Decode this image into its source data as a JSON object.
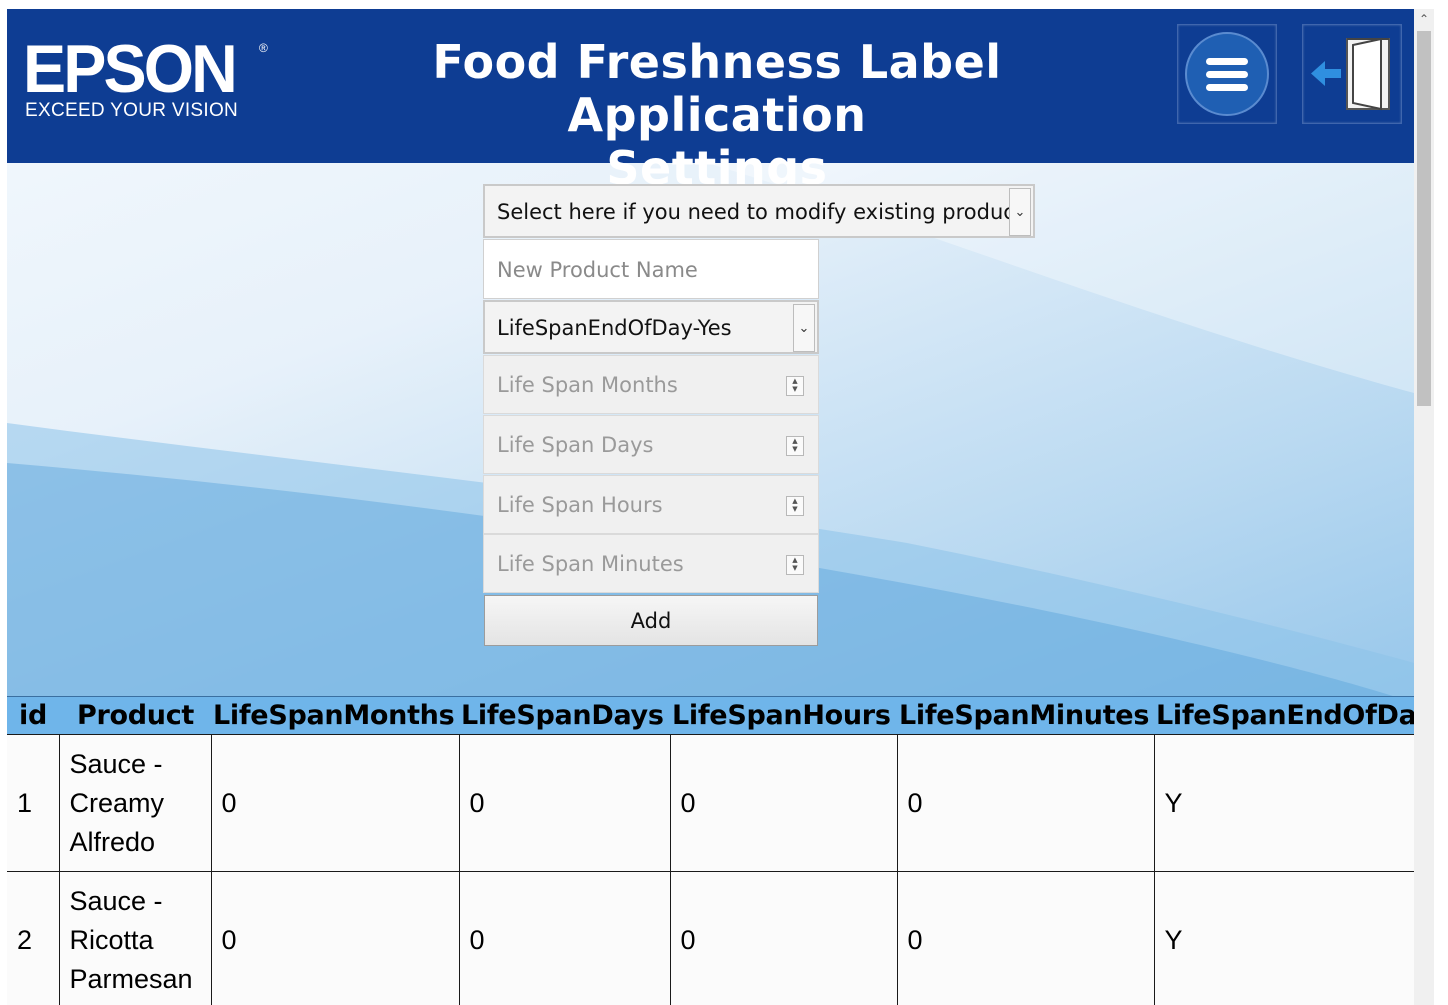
{
  "header": {
    "logo_text": "EPSON",
    "logo_tagline": "EXCEED YOUR VISION",
    "title_line1": "Food Freshness Label Application",
    "title_line2": "Settings",
    "colors": {
      "header_bg": "#0e3d93",
      "table_header_bg": "#6fb5ea"
    },
    "menu_icon": "hamburger-menu-icon",
    "logout_icon": "logout-door-icon"
  },
  "form": {
    "product_select": {
      "value": "Select here if you need to modify existing product",
      "icon": "chevron-down-icon"
    },
    "new_product_name": {
      "placeholder": "New Product Name",
      "value": ""
    },
    "end_of_day_select": {
      "value": "LifeSpanEndOfDay-Yes",
      "icon": "chevron-down-icon"
    },
    "life_span_months": {
      "placeholder": "Life Span Months"
    },
    "life_span_days": {
      "placeholder": "Life Span Days"
    },
    "life_span_hours": {
      "placeholder": "Life Span Hours"
    },
    "life_span_minutes": {
      "placeholder": "Life Span Minutes"
    },
    "add_label": "Add"
  },
  "table": {
    "columns": [
      "id",
      "Product",
      "LifeSpanMonths",
      "LifeSpanDays",
      "LifeSpanHours",
      "LifeSpanMinutes",
      "LifeSpanEndOfDa"
    ],
    "rows": [
      [
        "1",
        "Sauce - Creamy Alfredo",
        "0",
        "0",
        "0",
        "0",
        "Y"
      ],
      [
        "2",
        "Sauce - Ricotta Parmesan",
        "0",
        "0",
        "0",
        "0",
        "Y"
      ]
    ]
  }
}
